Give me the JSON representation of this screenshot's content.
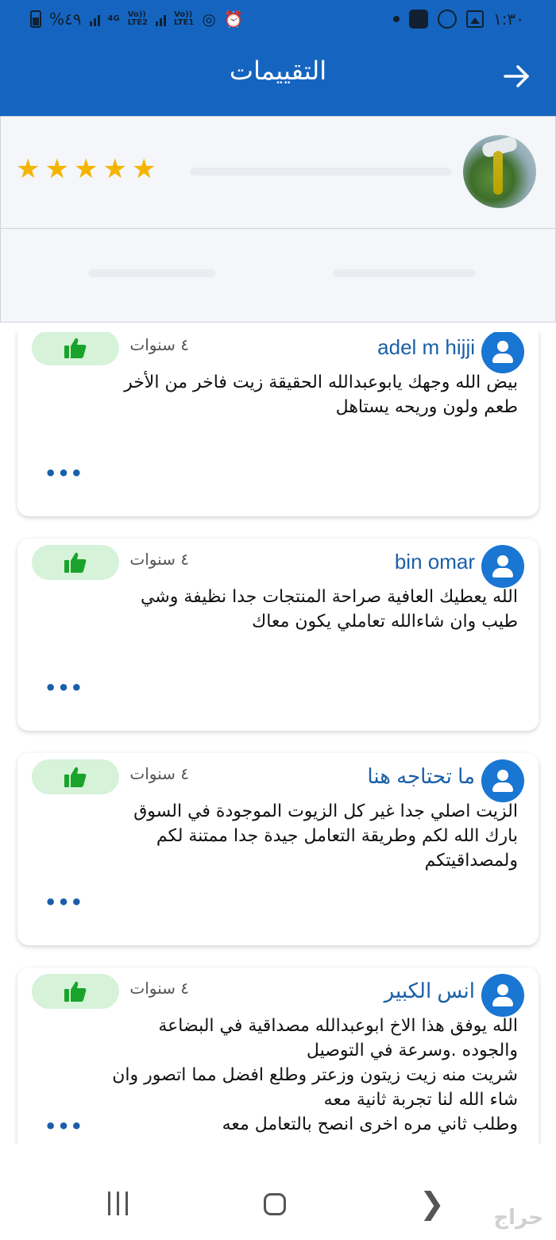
{
  "status_bar": {
    "battery_percent": "%٤٩",
    "time": "١:٣٠",
    "network_1": "4G",
    "network_lte_1": "LTE2",
    "network_lte_2": "LTE1",
    "volte_label": "Vo))"
  },
  "app_bar": {
    "title": "التقييمات",
    "back_icon": "arrow-right-icon"
  },
  "header": {
    "rating_stars": 5,
    "avatar": "product-oil-image"
  },
  "reviews": [
    {
      "username": "adel m hijji",
      "age": "٤ سنوات",
      "text": "بيض الله وجهك يابوعبدالله الحقيقة زيت فاخر من الأخر\nطعم ولون وريحه يستاهل",
      "more": "•••"
    },
    {
      "username": "bin omar",
      "age": "٤ سنوات",
      "text": "الله يعطيك العافية صراحة المنتجات جدا نظيفة وشي\nطيب وان شاءالله تعاملي يكون معاك",
      "more": "•••"
    },
    {
      "username": "ما تحتاجه هنا",
      "age": "٤ سنوات",
      "text": "الزيت اصلي جدا غير كل الزيوت الموجودة في السوق\nبارك الله لكم وطريقة التعامل جيدة جدا ممتنة لكم\nولمصداقيتكم",
      "more": "•••"
    },
    {
      "username": "انس الكبير",
      "age": "٤ سنوات",
      "text": "الله يوفق هذا الاخ ابوعبدالله مصداقية في البضاعة\nوالجوده .وسرعة في التوصيل\nشريت منه زيت زيتون وزعتر وطلع افضل مما اتصور وان\nشاء الله لنا تجربة ثانية معه\nوطلب ثاني مره اخرى انصح بالتعامل معه",
      "more": "•••"
    }
  ],
  "colors": {
    "primary": "#1565c0",
    "star": "#f5b400",
    "like_bg": "#d6f2d9",
    "like_icon": "#1aa32a",
    "username": "#1a5fa8"
  },
  "nav": {
    "recent_icon": "recent-apps-icon",
    "home_icon": "home-icon",
    "back_icon": "back-icon",
    "watermark": "حراج"
  }
}
